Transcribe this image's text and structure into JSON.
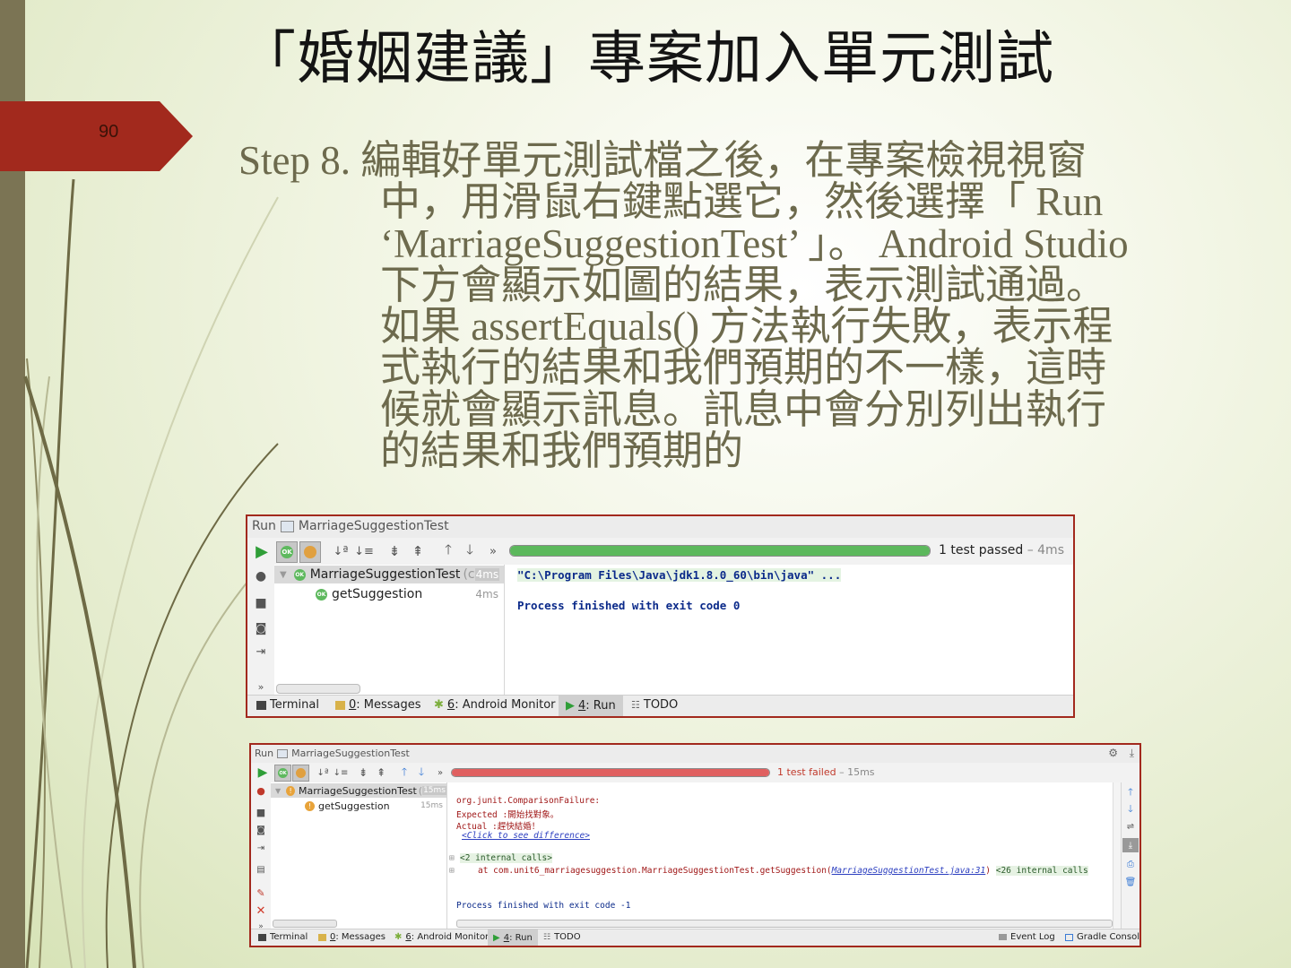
{
  "slide": {
    "title": "「婚姻建議」專案加入單元測試",
    "page_number": "90",
    "step_label": "Step 8. ",
    "step_text": "編輯好單元測試檔之後，在專案檢視視窗中，用滑鼠右鍵點選它，然後選擇「 Run ‘MarriageSuggestionTest’ 」。 Android Studio 下方會顯示如圖的結果，表示測試通過。如果 assertEquals() 方法執行失敗，表示程式執行的結果和我們預期的不一樣，這時候就會顯示訊息。訊息中會分別列出執行的結果和我們預期的"
  },
  "ide_pass": {
    "header_run": "Run",
    "header_config": "MarriageSuggestionTest",
    "status_main": "1 test passed",
    "status_time": " – 4ms",
    "progress": 1.0,
    "progress_color": "#5cb85c",
    "tree_root": "MarriageSuggestionTest",
    "tree_root_suffix": "(c",
    "tree_root_time": "4ms",
    "tree_child": "getSuggestion",
    "tree_child_time": "4ms",
    "console_line1": "\"C:\\Program Files\\Java\\jdk1.8.0_60\\bin\\java\" ...",
    "console_line2": "Process finished with exit code 0",
    "bottom_tabs": [
      {
        "prefix": "",
        "key": "",
        "label": "Terminal"
      },
      {
        "prefix": "",
        "key": "0",
        "label": ": Messages"
      },
      {
        "prefix": "",
        "key": "6",
        "label": ": Android Monitor"
      },
      {
        "prefix": "",
        "key": "4",
        "label": ": Run"
      },
      {
        "prefix": "",
        "key": "",
        "label": "TODO"
      }
    ]
  },
  "ide_fail": {
    "header_run": "Run",
    "header_config": "MarriageSuggestionTest",
    "status_main": "1 test failed",
    "status_time": " – 15ms",
    "progress": 1.0,
    "progress_color": "#e06060",
    "tree_root": "MarriageSuggestionTest",
    "tree_root_suffix": "(",
    "tree_root_time": "15ms",
    "tree_child": "getSuggestion",
    "tree_child_time": "15ms",
    "console_line1": "org.junit.ComparisonFailure:",
    "console_line2": "Expected :開始找對象。",
    "console_line3": "Actual   :趕快結婚！",
    "console_link": "<Click to see difference>",
    "console_line4": "<2 internal calls>",
    "console_line5_prefix": "at com.unit6_marriagesuggestion.MarriageSuggestionTest.getSuggestion(",
    "console_line5_link": "MarriageSuggestionTest.java:31",
    "console_line5_suffix": ")",
    "console_line5_tail": "<26 internal calls",
    "console_line6": "Process finished with exit code -1",
    "bottom_tabs": [
      {
        "key": "",
        "label": "Terminal"
      },
      {
        "key": "0",
        "label": ": Messages"
      },
      {
        "key": "6",
        "label": ": Android Monitor"
      },
      {
        "key": "4",
        "label": ": Run"
      },
      {
        "key": "",
        "label": "TODO"
      }
    ],
    "bottom_right": [
      "Event Log",
      "Gradle Console"
    ]
  },
  "colors": {
    "accent_red": "#a2291d",
    "sidebar": "#7b7454",
    "body_text": "#6d6a4d"
  }
}
